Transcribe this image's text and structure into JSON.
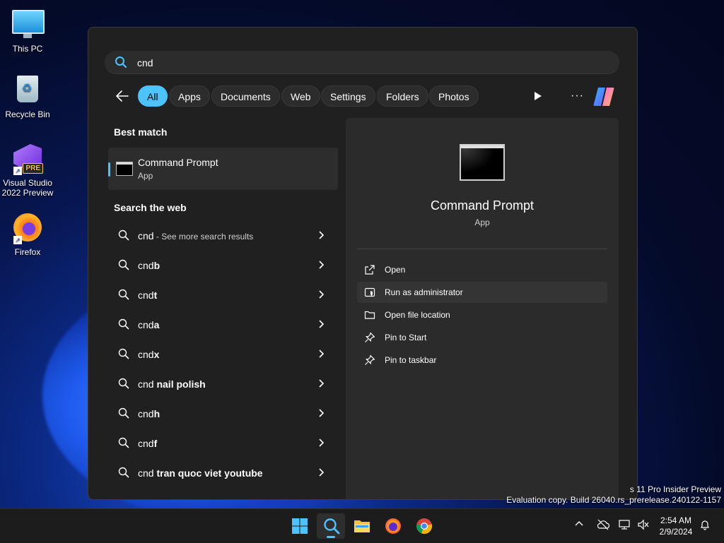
{
  "desktop": {
    "icons": [
      {
        "label": "This PC"
      },
      {
        "label": "Recycle Bin"
      },
      {
        "label": "Visual Studio 2022 Preview",
        "badge": "PRE"
      },
      {
        "label": "Firefox"
      }
    ],
    "watermark_line1": "s 11 Pro Insider Preview",
    "watermark_line2": "Evaluation copy. Build 26040.rs_prerelease.240122-1157"
  },
  "search": {
    "query": "cnd",
    "filters": [
      "All",
      "Apps",
      "Documents",
      "Web",
      "Settings",
      "Folders",
      "Photos"
    ],
    "active_filter": "All",
    "more_label": "···"
  },
  "results": {
    "best_match_title": "Best match",
    "best_match": {
      "name": "Command Prompt",
      "type": "App"
    },
    "web_title": "Search the web",
    "web_items": [
      {
        "prefix": "cnd",
        "bold": "",
        "suffix": " - See more search results"
      },
      {
        "prefix": "cnd",
        "bold": "b",
        "suffix": ""
      },
      {
        "prefix": "cnd",
        "bold": "t",
        "suffix": ""
      },
      {
        "prefix": "cnd",
        "bold": "a",
        "suffix": ""
      },
      {
        "prefix": "cnd",
        "bold": "x",
        "suffix": ""
      },
      {
        "prefix": "cnd ",
        "bold": "nail polish",
        "suffix": ""
      },
      {
        "prefix": "cnd",
        "bold": "h",
        "suffix": ""
      },
      {
        "prefix": "cnd",
        "bold": "f",
        "suffix": ""
      },
      {
        "prefix": "cnd ",
        "bold": "tran quoc viet youtube",
        "suffix": ""
      }
    ]
  },
  "preview": {
    "title": "Command Prompt",
    "type": "App",
    "actions": [
      {
        "label": "Open",
        "icon": "open-external-icon"
      },
      {
        "label": "Run as administrator",
        "icon": "shield-icon"
      },
      {
        "label": "Open file location",
        "icon": "folder-icon"
      },
      {
        "label": "Pin to Start",
        "icon": "pin-icon"
      },
      {
        "label": "Pin to taskbar",
        "icon": "pin-icon"
      }
    ]
  },
  "taskbar": {
    "time": "2:54 AM",
    "date": "2/9/2024",
    "accent": "#4cc2ff"
  }
}
